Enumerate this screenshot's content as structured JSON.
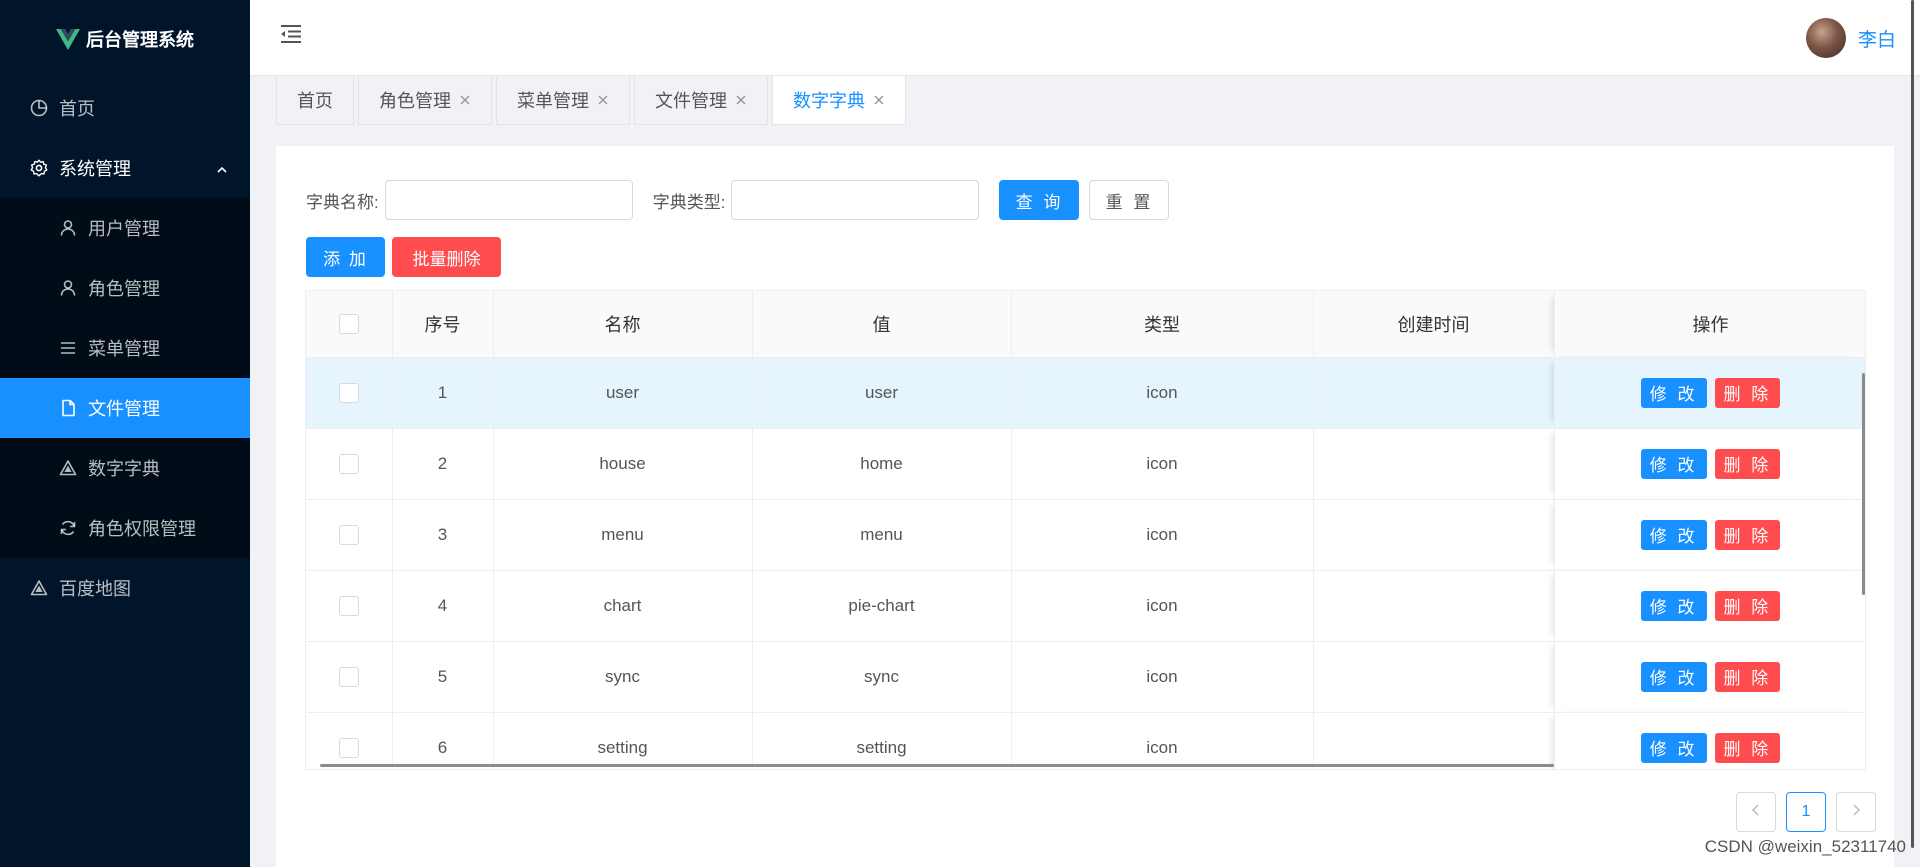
{
  "app": {
    "title": "后台管理系统"
  },
  "sidebar": {
    "home": "首页",
    "system": "系统管理",
    "sub": [
      {
        "label": "用户管理",
        "icon": "user-icon"
      },
      {
        "label": "角色管理",
        "icon": "user-icon"
      },
      {
        "label": "菜单管理",
        "icon": "menu-list-icon"
      },
      {
        "label": "文件管理",
        "icon": "file-icon"
      },
      {
        "label": "数字字典",
        "icon": "triangle-icon"
      },
      {
        "label": "角色权限管理",
        "icon": "sync-icon"
      }
    ],
    "map": "百度地图"
  },
  "header": {
    "user_name": "李白"
  },
  "tabs": [
    "首页",
    "角色管理",
    "菜单管理",
    "文件管理",
    "数字字典"
  ],
  "search": {
    "name_label": "字典名称:",
    "type_label": "字典类型:",
    "query": "查 询",
    "reset": "重 置"
  },
  "actions": {
    "add": "添 加",
    "batch_delete": "批量删除"
  },
  "table": {
    "headers": [
      "序号",
      "名称",
      "值",
      "类型",
      "创建时间",
      "操作"
    ],
    "rows": [
      {
        "id": "1",
        "name": "user",
        "value": "user",
        "type": "icon",
        "created": ""
      },
      {
        "id": "2",
        "name": "house",
        "value": "home",
        "type": "icon",
        "created": ""
      },
      {
        "id": "3",
        "name": "menu",
        "value": "menu",
        "type": "icon",
        "created": ""
      },
      {
        "id": "4",
        "name": "chart",
        "value": "pie-chart",
        "type": "icon",
        "created": ""
      },
      {
        "id": "5",
        "name": "sync",
        "value": "sync",
        "type": "icon",
        "created": ""
      },
      {
        "id": "6",
        "name": "setting",
        "value": "setting",
        "type": "icon",
        "created": ""
      }
    ],
    "edit": "修 改",
    "delete": "删 除"
  },
  "pagination": {
    "current": "1"
  },
  "watermark": "CSDN @weixin_52311740",
  "colors": {
    "primary": "#1890ff",
    "danger": "#ff4d4f",
    "sidebar": "#001529"
  }
}
